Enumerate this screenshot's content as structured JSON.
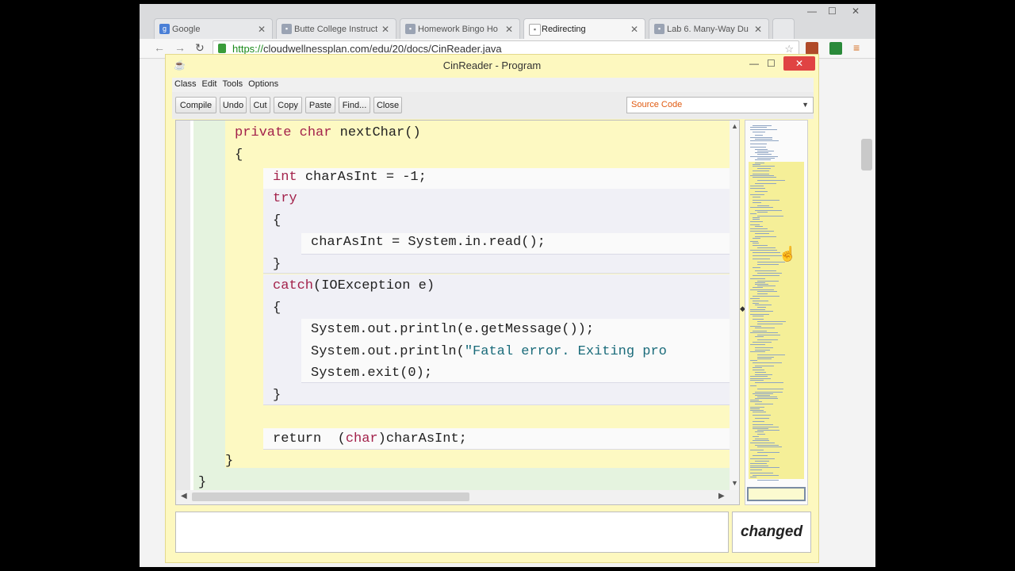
{
  "browser": {
    "tabs": [
      {
        "label": "Google",
        "favicon": "google-icon",
        "active": false
      },
      {
        "label": "Butte College Instruct",
        "favicon": "document-icon",
        "active": false
      },
      {
        "label": "Homework Bingo Ho",
        "favicon": "document-icon",
        "active": false
      },
      {
        "label": "Redirecting",
        "favicon": "document-icon",
        "active": true
      },
      {
        "label": "Lab 6. Many-Way Du",
        "favicon": "document-icon",
        "active": false
      }
    ],
    "url_scheme": "https://",
    "url_rest": "cloudwellnessplan.com/edu/20/docs/CinReader.java"
  },
  "app": {
    "title": "CinReader - Program",
    "menu": [
      "Class",
      "Edit",
      "Tools",
      "Options"
    ],
    "buttons": {
      "compile": "Compile",
      "undo": "Undo",
      "cut": "Cut",
      "copy": "Copy",
      "paste": "Paste",
      "find": "Find...",
      "close": "Close"
    },
    "view_select": "Source Code",
    "status": "changed",
    "colors": {
      "keyword": "#a3224b",
      "string": "#1a6b7a",
      "frame": "#fdf8bf",
      "class_bg": "#e5f3df",
      "method_bg": "#fdf9c2"
    }
  },
  "code": {
    "l1_kw1": "private",
    "l1_kw2": "char",
    "l1_rest": "nextChar()",
    "l2": "{",
    "l3_kw": "int",
    "l3_rest": "charAsInt = -1;",
    "l4_kw": "try",
    "l5": "{",
    "l6": "charAsInt = System.in.read();",
    "l7": "}",
    "l8_kw": "catch",
    "l8_rest": "(IOException e)",
    "l9": "{",
    "l10": "System.out.println(e.getMessage());",
    "l11_pre": "System.out.println(",
    "l11_str": "\"Fatal error. Exiting pro",
    "l12": "System.exit(0);",
    "l13": "}",
    "l14_kw": "return",
    "l14_mid": "(",
    "l14_kw2": "char",
    "l14_rest": ")charAsInt;",
    "l15": "}",
    "l16": "}"
  }
}
